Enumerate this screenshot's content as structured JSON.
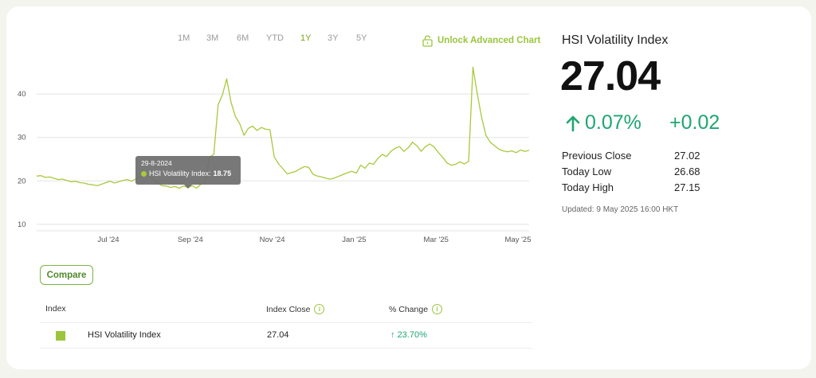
{
  "ranges": [
    {
      "label": "1M",
      "active": false
    },
    {
      "label": "3M",
      "active": false
    },
    {
      "label": "6M",
      "active": false
    },
    {
      "label": "YTD",
      "active": false
    },
    {
      "label": "1Y",
      "active": true
    },
    {
      "label": "3Y",
      "active": false
    },
    {
      "label": "5Y",
      "active": false
    }
  ],
  "unlock_label": "Unlock Advanced Chart",
  "chart_data": {
    "type": "line",
    "x_ticks": [
      "Jul '24",
      "Sep '24",
      "Nov '24",
      "Jan '25",
      "Mar '25",
      "May '25"
    ],
    "y_ticks": [
      10,
      20,
      30,
      40
    ],
    "ylim": [
      8.5,
      47
    ],
    "grid": "horizontal",
    "series": [
      {
        "name": "HSI Volatility Index",
        "color": "#a8c93c",
        "values": [
          21.1,
          21.2,
          20.8,
          20.9,
          20.6,
          20.3,
          20.4,
          20.1,
          19.8,
          19.9,
          19.6,
          19.5,
          19.2,
          19.1,
          18.9,
          19.2,
          19.6,
          19.9,
          19.5,
          19.8,
          20.1,
          20.3,
          19.9,
          20.5,
          20.9,
          21.4,
          21.1,
          20.4,
          19.5,
          18.9,
          18.8,
          18.5,
          18.7,
          18.3,
          18.8,
          18.5,
          18.9,
          18.3,
          19.2,
          19.6,
          25.5,
          26.1,
          37.5,
          39.8,
          43.5,
          38.1,
          34.8,
          33.2,
          30.5,
          32.1,
          32.6,
          31.6,
          32.3,
          31.9,
          31.8,
          25.5,
          23.9,
          22.8,
          21.6,
          21.9,
          22.2,
          22.8,
          23.3,
          23.1,
          21.5,
          21.1,
          20.9,
          20.6,
          20.4,
          20.7,
          21.1,
          21.5,
          21.9,
          22.2,
          21.8,
          23.6,
          22.9,
          24.1,
          23.8,
          25.2,
          26.1,
          25.6,
          26.8,
          27.5,
          27.9,
          26.8,
          27.6,
          28.9,
          28.1,
          26.8,
          27.9,
          28.5,
          27.8,
          26.5,
          25.4,
          24.1,
          23.6,
          23.8,
          24.4,
          23.9,
          24.5,
          46.2,
          40.1,
          34.6,
          30.5,
          28.9,
          28.1,
          27.3,
          26.9,
          26.7,
          26.9,
          26.5,
          27.1,
          26.8,
          27.04
        ]
      }
    ],
    "tooltip": {
      "date": "29-8-2024",
      "series": "HSI Volatility Index:",
      "value": "18.75"
    }
  },
  "info": {
    "title": "HSI Volatility Index",
    "price": "27.04",
    "change_pct": "0.07%",
    "change_abs": "+0.02",
    "stats": [
      {
        "label": "Previous Close",
        "value": "27.02"
      },
      {
        "label": "Today Low",
        "value": "26.68"
      },
      {
        "label": "Today High",
        "value": "27.15"
      }
    ],
    "updated": "Updated: 9 May 2025 16:00 HKT"
  },
  "compare_label": "Compare",
  "table": {
    "headers": {
      "index": "Index",
      "close": "Index Close",
      "pct": "% Change"
    },
    "rows": [
      {
        "name": "HSI Volatility Index",
        "close": "27.04",
        "pct": "23.70%",
        "color": "#9bc53d"
      }
    ]
  }
}
